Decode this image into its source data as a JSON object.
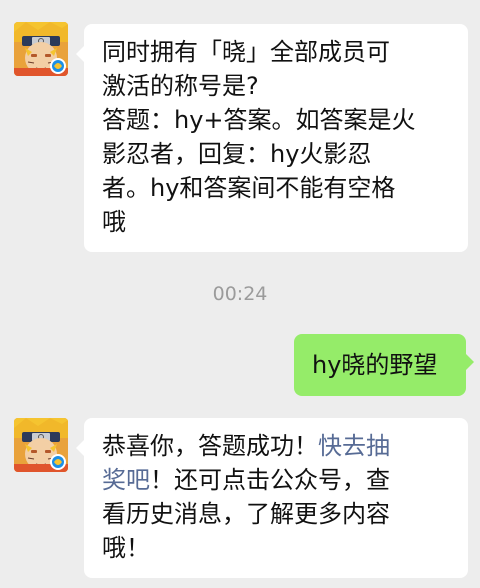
{
  "messages": [
    {
      "sender": "incoming",
      "lines": [
        "同时拥有「晓」全部成员可",
        "激活的称号是?",
        "答题：hy+答案。如答案是火",
        "影忍者，回复：hy火影忍",
        "者。hy和答案间不能有空格",
        "哦"
      ]
    },
    {
      "sender": "outgoing",
      "text": "hy晓的野望"
    },
    {
      "sender": "incoming",
      "line1_prefix": "恭喜你，答题成功！",
      "line1_link": "快去抽",
      "line2_link": "奖吧",
      "line2_suffix": "！还可点击公众号，查",
      "line3": "看历史消息，了解更多内容",
      "line4": "哦！"
    }
  ],
  "timestamp": "00:24",
  "colors": {
    "background": "#ededed",
    "incoming_bubble": "#ffffff",
    "outgoing_bubble": "#95ec69",
    "link": "#576b95",
    "timestamp": "#9b9b9b"
  },
  "avatar_icon": "ninja-avatar-icon"
}
